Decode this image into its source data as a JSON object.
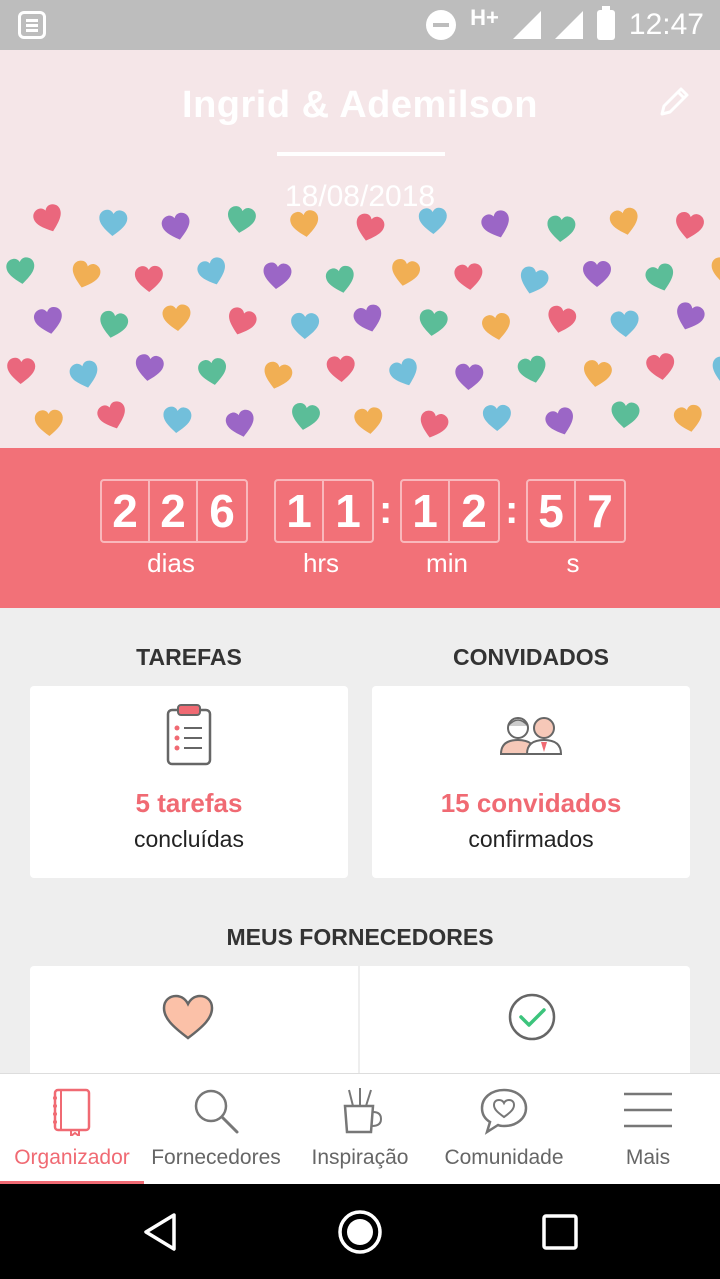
{
  "status_bar": {
    "network": "H+",
    "time": "12:47"
  },
  "header": {
    "couple": "Ingrid & Ademilson",
    "date": "18/08/2018"
  },
  "countdown": {
    "days": [
      "2",
      "2",
      "6"
    ],
    "hours": [
      "1",
      "1"
    ],
    "minutes": [
      "1",
      "2"
    ],
    "seconds": [
      "5",
      "7"
    ],
    "labels": {
      "days": "dias",
      "hours": "hrs",
      "minutes": "min",
      "seconds": "s"
    }
  },
  "tasks": {
    "title": "TAREFAS",
    "value": "5 tarefas",
    "sub": "concluídas"
  },
  "guests": {
    "title": "CONVIDADOS",
    "value": "15 convidados",
    "sub": "confirmados"
  },
  "suppliers": {
    "title": "MEUS FORNECEDORES"
  },
  "nav": {
    "items": [
      {
        "label": "Organizador",
        "icon": "notebook-icon"
      },
      {
        "label": "Fornecedores",
        "icon": "search-icon"
      },
      {
        "label": "Inspiração",
        "icon": "brush-cup-icon"
      },
      {
        "label": "Comunidade",
        "icon": "chat-heart-icon"
      },
      {
        "label": "Mais",
        "icon": "menu-icon"
      }
    ]
  },
  "colors": {
    "accent": "#f06a73",
    "countdown_bg": "#f27178",
    "header_bg": "#f5e6e8"
  }
}
